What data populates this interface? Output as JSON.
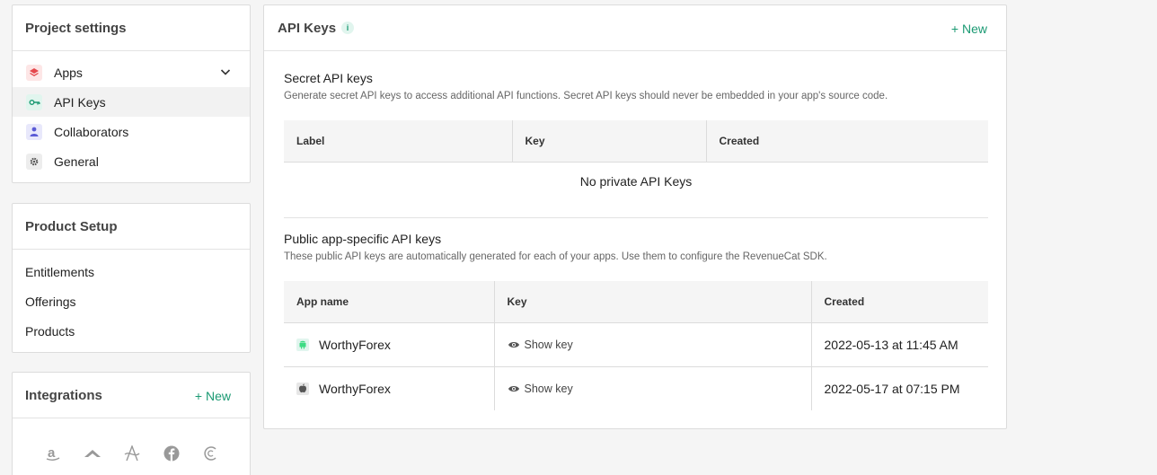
{
  "project_settings": {
    "title": "Project settings",
    "items": [
      {
        "label": "Apps"
      },
      {
        "label": "API Keys"
      },
      {
        "label": "Collaborators"
      },
      {
        "label": "General"
      }
    ]
  },
  "product_setup": {
    "title": "Product Setup",
    "items": [
      {
        "label": "Entitlements"
      },
      {
        "label": "Offerings"
      },
      {
        "label": "Products"
      }
    ]
  },
  "integrations": {
    "title": "Integrations",
    "new_label": "New",
    "icons": [
      "amazon-icon",
      "app-store-icon",
      "apple-search-ads-icon",
      "facebook-icon",
      "clevertap-icon"
    ]
  },
  "api_keys": {
    "title": "API Keys",
    "info_label": "i",
    "new_label": "New",
    "secret": {
      "title": "Secret API keys",
      "description": "Generate secret API keys to access additional API functions. Secret API keys should never be embedded in your app's source code.",
      "columns": [
        "Label",
        "Key",
        "Created"
      ],
      "empty_text": "No private API Keys"
    },
    "public": {
      "title": "Public app-specific API keys",
      "description": "These public API keys are automatically generated for each of your apps. Use them to configure the RevenueCat SDK.",
      "columns": [
        "App name",
        "Key",
        "Created"
      ],
      "rows": [
        {
          "platform": "android-icon",
          "app_name": "WorthyForex",
          "key_label": "Show key",
          "created": "2022-05-13 at 11:45 AM"
        },
        {
          "platform": "apple-icon",
          "app_name": "WorthyForex",
          "key_label": "Show key",
          "created": "2022-05-17 at 07:15 PM"
        }
      ]
    }
  },
  "colors": {
    "accent": "#1b9a73",
    "background": "#f5f5f5"
  }
}
